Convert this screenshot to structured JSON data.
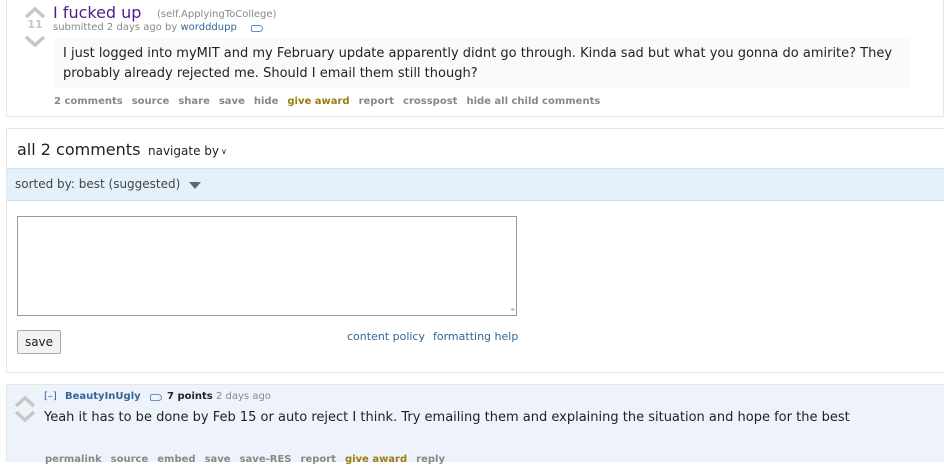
{
  "post": {
    "score": "11",
    "title": "I fucked up",
    "domain": "(self.ApplyingToCollege)",
    "tagline_prefix": "submitted 2 days ago by ",
    "author": "wordddupp",
    "selftext": "I just logged into myMIT and my February update apparently didnt go through. Kinda sad but what you gonna do amirite? They probably already rejected me. Should I email them still though?",
    "buttons": {
      "comments": "2 comments",
      "source": "source",
      "share": "share",
      "save": "save",
      "hide": "hide",
      "give_award": "give award",
      "report": "report",
      "crosspost": "crosspost",
      "hide_children": "hide all child comments"
    }
  },
  "comments_header": {
    "title": "all 2 comments",
    "navigate_by": "navigate by",
    "sorted_by": "sorted by: best (suggested)"
  },
  "reply_form": {
    "save_label": "save",
    "content_policy": "content policy",
    "formatting_help": "formatting help"
  },
  "comment": {
    "collapse": "[–]",
    "author": "BeautyInUgly",
    "points": "7 points",
    "time": "2 days ago",
    "body": "Yeah it has to be done by Feb 15 or auto reject I think. Try emailing them and explaining the situation and hope for the best",
    "buttons": {
      "permalink": "permalink",
      "source": "source",
      "embed": "embed",
      "save": "save",
      "save_res": "save-RES",
      "report": "report",
      "give_award": "give award",
      "reply": "reply"
    }
  },
  "colors": {
    "title": "#551a8b",
    "link": "#336699",
    "sort_bar": "#e4f1fb",
    "award": "#9a7d0a",
    "comment_bg": "#eef2fb"
  }
}
